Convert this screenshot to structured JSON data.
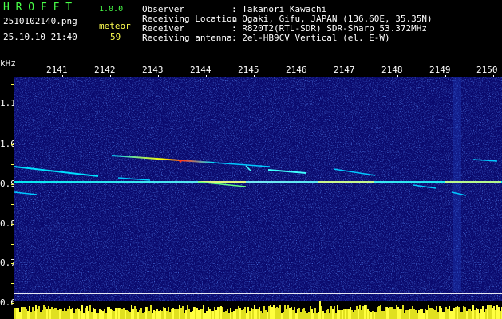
{
  "header": {
    "app_name": "H R O F F T",
    "version": "1.0.0",
    "filename": "2510102140.png",
    "datetime": "25.10.10 21:40",
    "meteor_label": "meteor",
    "meteor_count": "59",
    "fields": [
      {
        "label": "Observer",
        "value": ": Takanori Kawachi"
      },
      {
        "label": "Receiving Location",
        "value": ": Ogaki, Gifu, JAPAN (136.60E, 35.35N)"
      },
      {
        "label": "Receiver",
        "value": ": R820T2(RTL-SDR) SDR-Sharp 53.372MHz"
      },
      {
        "label": "Receiving antenna",
        "value": ": 2el-HB9CV Vertical (el. E-W)"
      }
    ]
  },
  "axes": {
    "y_unit": "kHz",
    "y_ticks": [
      "1.1",
      "1.0",
      "0.9",
      "0.8",
      "0.7",
      "0.6"
    ],
    "x_ticks": [
      "2141",
      "2142",
      "2143",
      "2144",
      "2145",
      "2146",
      "2147",
      "2148",
      "2149",
      "2150"
    ]
  },
  "colors": {
    "background": "#000000",
    "spectrum_bg": "#0a0a6e",
    "label_green": "#48ff48",
    "label_white": "#ffffff",
    "tick_yellow": "#ffff50"
  }
}
